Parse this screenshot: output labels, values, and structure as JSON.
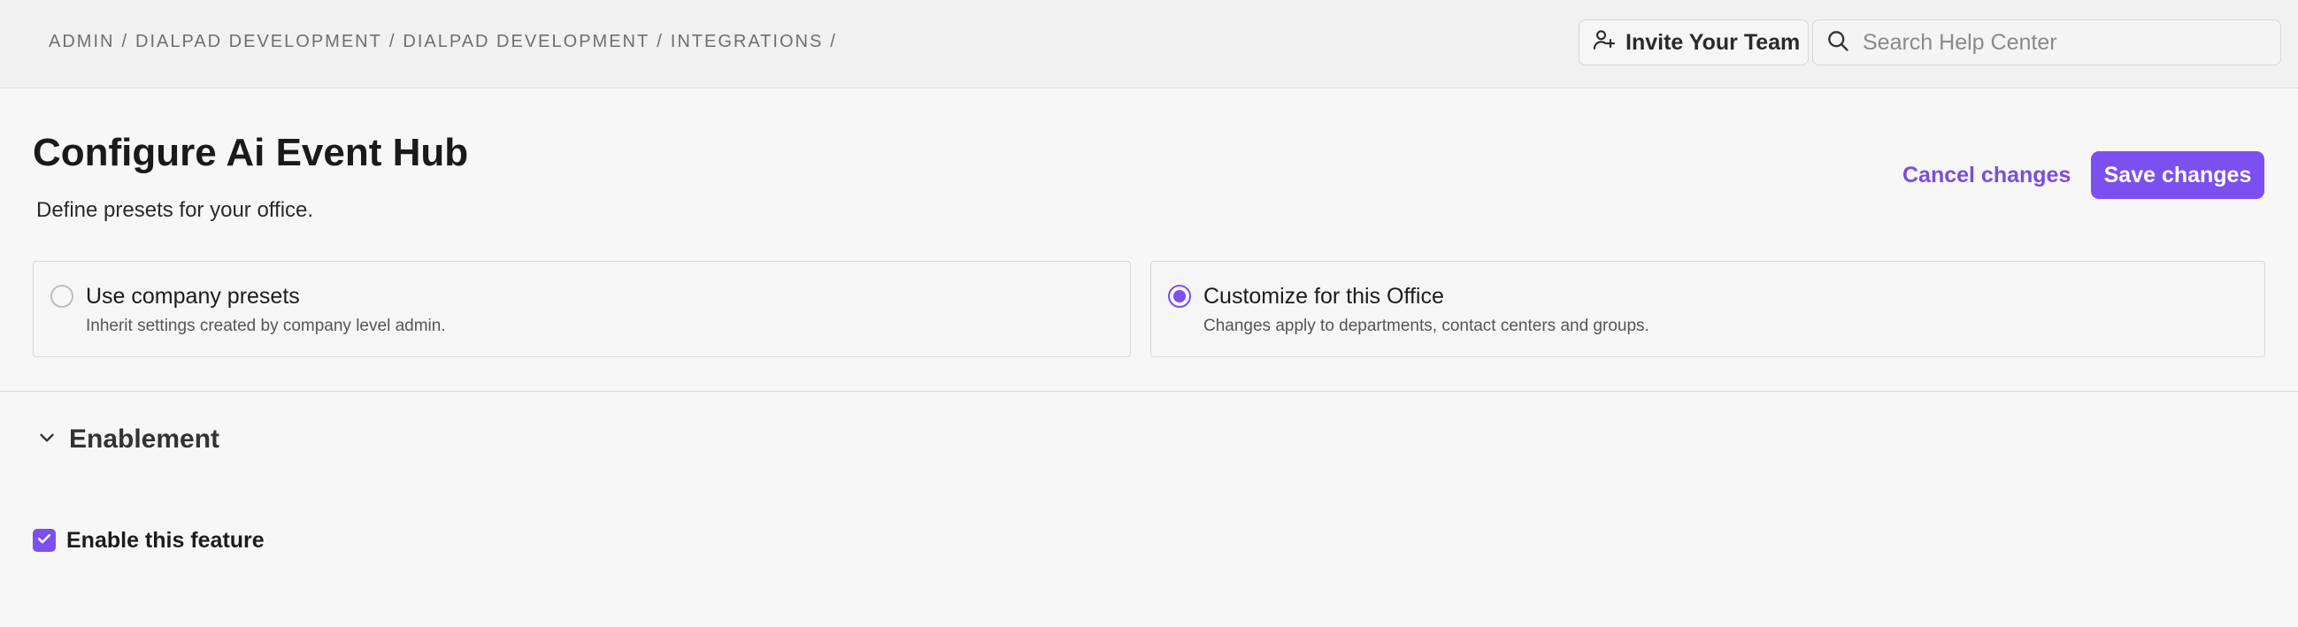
{
  "header": {
    "breadcrumb": [
      {
        "label": "ADMIN"
      },
      {
        "label": "DIALPAD DEVELOPMENT"
      },
      {
        "label": "DIALPAD DEVELOPMENT"
      },
      {
        "label": "INTEGRATIONS"
      }
    ],
    "separator": "/",
    "invite_label": "Invite Your Team",
    "invite_icon": "user-plus-icon",
    "search": {
      "placeholder": "Search Help Center",
      "value": "",
      "icon": "search-icon"
    }
  },
  "page": {
    "title": "Configure Ai Event Hub",
    "subtitle": "Define presets for your office.",
    "cancel_label": "Cancel changes",
    "save_label": "Save changes"
  },
  "options": [
    {
      "title": "Use company presets",
      "description": "Inherit settings created by company level admin.",
      "selected": false
    },
    {
      "title": "Customize for this Office",
      "description": "Changes apply to departments, contact centers and groups.",
      "selected": true
    }
  ],
  "section": {
    "title": "Enablement",
    "expanded": true,
    "icon": "chevron-down-icon",
    "feature": {
      "label": "Enable this feature",
      "checked": true,
      "icon": "check-icon"
    }
  },
  "colors": {
    "accent": "#7c4ff0",
    "accent_text": "#7b4ddb",
    "background": "#f7f7f7",
    "topbar": "#f1f1f1"
  }
}
